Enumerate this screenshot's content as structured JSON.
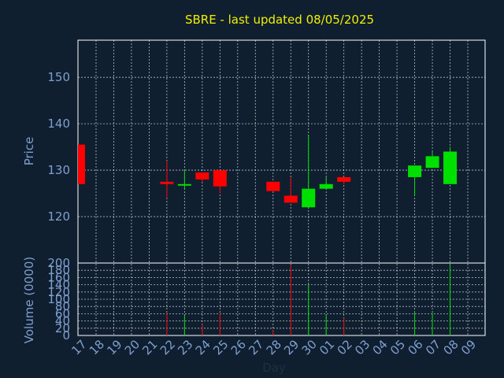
{
  "chart_data": {
    "type": "candlestick",
    "title": "SBRE - last updated 08/05/2025",
    "xlabel": "Day",
    "price_axis": {
      "label": "Price",
      "ylim": [
        110,
        158
      ],
      "ticks": [
        120,
        130,
        140,
        150
      ]
    },
    "volume_axis": {
      "label": "Volume (0000)",
      "ylim": [
        0,
        200
      ],
      "ticks": [
        0,
        20,
        40,
        60,
        80,
        100,
        120,
        140,
        160,
        180,
        200
      ]
    },
    "x_ticks": [
      "17",
      "18",
      "19",
      "20",
      "21",
      "22",
      "23",
      "24",
      "25",
      "26",
      "27",
      "28",
      "29",
      "30",
      "01",
      "02",
      "03",
      "04",
      "05",
      "06",
      "07",
      "08",
      "09"
    ],
    "colors": {
      "up": "#00e000",
      "down": "#ff0000",
      "title": "#f0f000",
      "axis_text": "#7f9fcf",
      "background": "#0f1f30",
      "grid": "#ffffff"
    },
    "grid": true,
    "candles": [
      {
        "day": "17",
        "open": 135.5,
        "close": 127.0,
        "high": 135.5,
        "low": 127.0,
        "volume": 0
      },
      {
        "day": "22",
        "open": 127.5,
        "close": 127.0,
        "high": 132.0,
        "low": 124.0,
        "volume": 60
      },
      {
        "day": "23",
        "open": 127.0,
        "close": 127.0,
        "high": 130.0,
        "low": 126.0,
        "volume": 55
      },
      {
        "day": "24",
        "open": 129.5,
        "close": 128.0,
        "high": 129.5,
        "low": 127.5,
        "volume": 30
      },
      {
        "day": "25",
        "open": 130.0,
        "close": 126.5,
        "high": 130.0,
        "low": 125.0,
        "volume": 62
      },
      {
        "day": "28",
        "open": 127.5,
        "close": 125.5,
        "high": 127.5,
        "low": 125.5,
        "volume": 15
      },
      {
        "day": "29",
        "open": 124.5,
        "close": 123.0,
        "high": 128.5,
        "low": 123.0,
        "volume": 195
      },
      {
        "day": "30",
        "open": 122.0,
        "close": 126.0,
        "high": 137.5,
        "low": 122.0,
        "volume": 140
      },
      {
        "day": "01",
        "open": 126.0,
        "close": 127.0,
        "high": 128.5,
        "low": 126.0,
        "volume": 55
      },
      {
        "day": "02",
        "open": 128.5,
        "close": 127.5,
        "high": 128.5,
        "low": 127.0,
        "volume": 48
      },
      {
        "day": "06",
        "open": 128.5,
        "close": 131.0,
        "high": 131.0,
        "low": 124.5,
        "volume": 65
      },
      {
        "day": "07",
        "open": 130.5,
        "close": 133.0,
        "high": 134.0,
        "low": 130.5,
        "volume": 62
      },
      {
        "day": "08",
        "open": 127.0,
        "close": 134.0,
        "high": 135.0,
        "low": 127.0,
        "volume": 195
      }
    ]
  }
}
